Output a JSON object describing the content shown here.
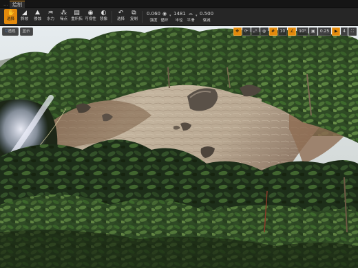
{
  "tabs": [
    "...",
    "绘制"
  ],
  "tools": [
    {
      "label": "选择",
      "icon": "select-icon",
      "active": true
    },
    {
      "label": "斜坡",
      "icon": "ramp-icon"
    },
    {
      "label": "侵蚀",
      "icon": "erosion-icon"
    },
    {
      "label": "水力",
      "icon": "hydro-icon"
    },
    {
      "label": "噪点",
      "icon": "noise-icon"
    },
    {
      "label": "重所拓",
      "icon": "retopo-icon"
    },
    {
      "label": "可视性",
      "icon": "visibility-icon"
    },
    {
      "label": "镜像",
      "icon": "mirror-icon"
    },
    {
      "label": "选择",
      "icon": "region-select-icon"
    },
    {
      "label": "复制",
      "icon": "copy-icon"
    }
  ],
  "settings": [
    {
      "value": "0.060",
      "label": "强度"
    },
    {
      "value": "",
      "label": "循环",
      "icon": "cycle-icon"
    },
    {
      "value": "1481",
      "label": "半径"
    },
    {
      "value": "",
      "label": "平滑",
      "icon": "smooth-icon"
    },
    {
      "value": "0.500",
      "label": "衰减"
    }
  ],
  "viewport": {
    "perspective_label": "透视",
    "lit_label": "显示",
    "right_icons": [
      "translate-icon",
      "rotate-icon",
      "scale-icon",
      "world-icon",
      "snap-icon",
      "grid-icon",
      "angle-icon",
      "scale-snap-icon",
      "camera-speed-icon",
      "maximize-icon"
    ],
    "right_values": [
      "10",
      "10°",
      "0.25",
      "4"
    ]
  },
  "colors": {
    "accent": "#e38a0c",
    "toolbar": "#262626"
  }
}
